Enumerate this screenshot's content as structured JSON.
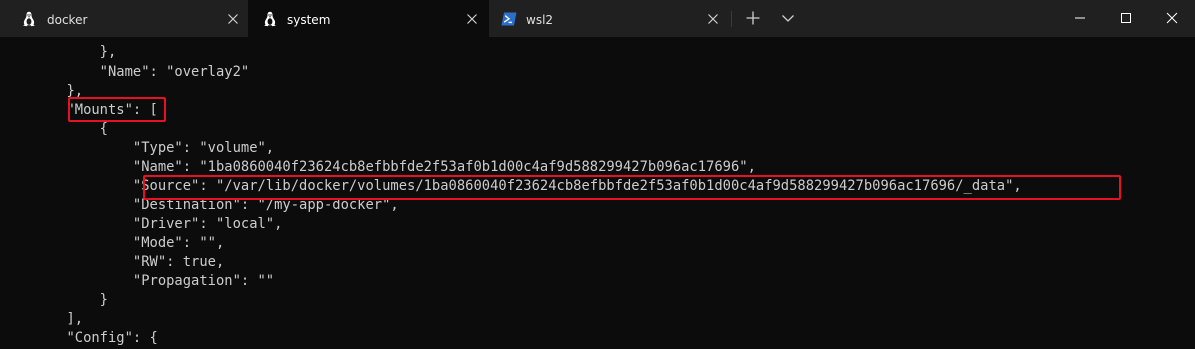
{
  "tabs": [
    {
      "label": "docker",
      "icon": "linux-penguin-icon",
      "active": false
    },
    {
      "label": "system",
      "icon": "linux-penguin-icon",
      "active": true
    },
    {
      "label": "wsl2",
      "icon": "powershell-icon",
      "active": false
    }
  ],
  "toolbar": {
    "new_tab_icon": "plus-icon",
    "dropdown_icon": "chevron-down-icon"
  },
  "window_controls": {
    "minimize_icon": "minimize-icon",
    "maximize_icon": "maximize-icon",
    "close_icon": "close-icon"
  },
  "terminal": {
    "lines": [
      "            },",
      "            \"Name\": \"overlay2\"",
      "        },",
      "        \"Mounts\": [",
      "            {",
      "                \"Type\": \"volume\",",
      "                \"Name\": \"1ba0860040f23624cb8efbbfde2f53af0b1d00c4af9d588299427b096ac17696\",",
      "                \"Source\": \"/var/lib/docker/volumes/1ba0860040f23624cb8efbbfde2f53af0b1d00c4af9d588299427b096ac17696/_data\",",
      "                \"Destination\": \"/my-app-docker\",",
      "                \"Driver\": \"local\",",
      "                \"Mode\": \"\",",
      "                \"RW\": true,",
      "                \"Propagation\": \"\"",
      "            }",
      "        ],",
      "        \"Config\": {"
    ]
  },
  "colors": {
    "background": "#0c0c0c",
    "titlebar": "#202020",
    "text": "#cccccc",
    "highlight_border": "#e81123"
  }
}
